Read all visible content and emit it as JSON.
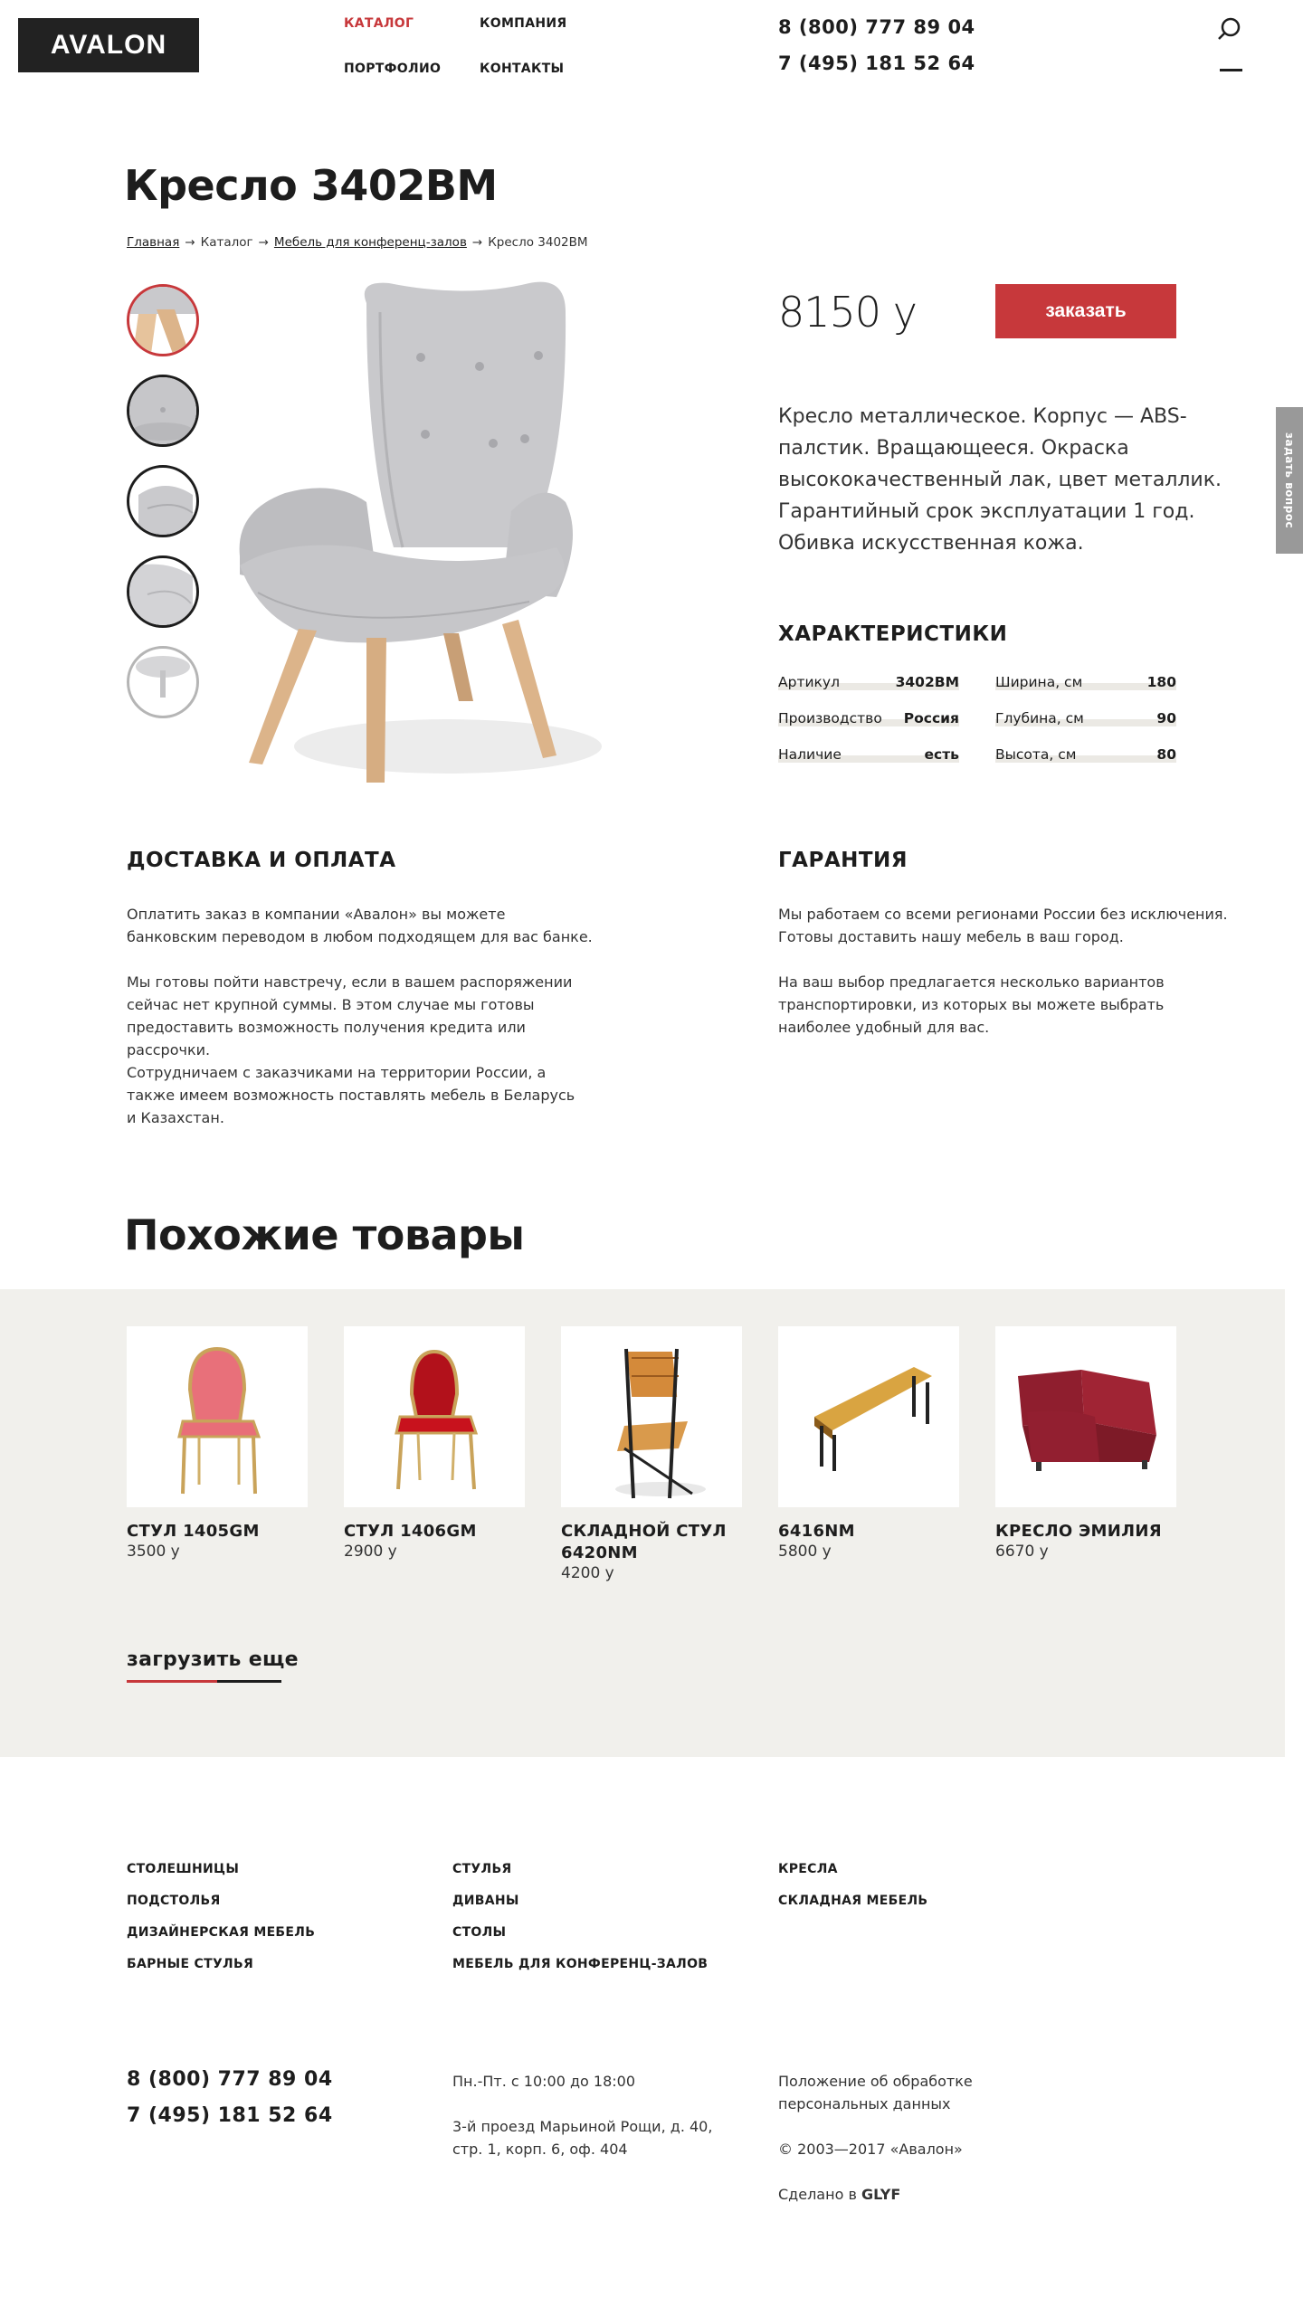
{
  "header": {
    "logo": "AVALON",
    "nav": {
      "catalog": "КАТАЛОГ",
      "company": "КОМПАНИЯ",
      "portfolio": "ПОРТФОЛИО",
      "contacts": "КОНТАКТЫ"
    },
    "phones": [
      "8 (800) 777 89 04",
      "7 (495) 181 52 64"
    ],
    "icons": {
      "search": "search-icon",
      "menu": "menu-icon"
    }
  },
  "product": {
    "title": "Кресло 3402BM",
    "breadcrumb": [
      "Главная",
      "Каталог",
      "Мебель для конференц-залов",
      "Кресло 3402BM"
    ],
    "price": "8150 y",
    "order_label": "заказать",
    "description": "Кресло металлическое. Корпус — ABS-палстик. Вращающееся. Окраска высококачественный лак, цвет металлик. Гарантийный срок эксплуатации 1 год. Обивка искусственная кожа.",
    "specs_title": "ХАРАКТЕРИСТИКИ",
    "specs_left": [
      {
        "label": "Артикул",
        "value": "3402BM"
      },
      {
        "label": "Производство",
        "value": "Россия"
      },
      {
        "label": "Наличие",
        "value": "есть"
      }
    ],
    "specs_right": [
      {
        "label": "Ширина, см",
        "value": "180"
      },
      {
        "label": "Глубина, см",
        "value": "90"
      },
      {
        "label": "Высота, см",
        "value": "80"
      }
    ],
    "colors": {
      "accent": "#c7383b",
      "upholstery": "#c9c9cc",
      "wood": "#dcb48a"
    }
  },
  "side_tab": "задать вопрос",
  "delivery": {
    "title": "ДОСТАВКА И ОПЛАТА",
    "p1": "Оплатить заказ в компании «Авалон» вы можете банковским переводом в любом подходящем для вас банке.",
    "p2": "Мы готовы пойти навстречу, если в вашем распоряжении сейчас нет крупной суммы. В этом случае мы готовы предоставить возможность получения кредита или рассрочки.",
    "p3": "Сотрудничаем с заказчиками на территории России, а также имеем возможность поставлять мебель в Беларусь и Казахстан."
  },
  "warranty": {
    "title": "ГАРАНТИЯ",
    "p1": "Мы работаем со всеми регионами России без исключения. Готовы доставить нашу мебель в ваш город.",
    "p2": "На ваш выбор предлагается несколько вариантов транспортировки, из которых вы можете выбрать наиболее удобный для вас."
  },
  "similar": {
    "title": "Похожие товары",
    "items": [
      {
        "name": "СТУЛ 1405GM",
        "price": "3500 y"
      },
      {
        "name": "СТУЛ 1406GM",
        "price": "2900 y"
      },
      {
        "name": "СКЛАДНОЙ СТУЛ 6420NM",
        "price": "4200 y"
      },
      {
        "name": "6416NM",
        "price": "5800 y"
      },
      {
        "name": "КРЕСЛО ЭМИЛИЯ",
        "price": "6670 y"
      }
    ],
    "load_more": "загрузить еще"
  },
  "footer": {
    "col1": [
      "СТОЛЕШНИЦЫ",
      "ПОДСТОЛЬЯ",
      "ДИЗАЙНЕРСКАЯ МЕБЕЛЬ",
      "БАРНЫЕ СТУЛЬЯ"
    ],
    "col2": [
      "СТУЛЬЯ",
      "ДИВАНЫ",
      "СТОЛЫ",
      "МЕБЕЛЬ ДЛЯ КОНФЕРЕНЦ-ЗАЛОВ"
    ],
    "col3": [
      "КРЕСЛА",
      "СКЛАДНАЯ МЕБЕЛЬ"
    ],
    "phones": [
      "8 (800) 777 89 04",
      "7 (495) 181 52 64"
    ],
    "hours": "Пн.-Пт. с 10:00 до 18:00",
    "address": "3-й проезд Марьиной Рощи, д. 40, стр. 1, корп. 6, оф. 404",
    "policy": "Положение об обработке персональных данных",
    "copyright": "© 2003—2017 «Авалон»",
    "made_by_prefix": "Сделано в",
    "made_by": "GLYF"
  }
}
